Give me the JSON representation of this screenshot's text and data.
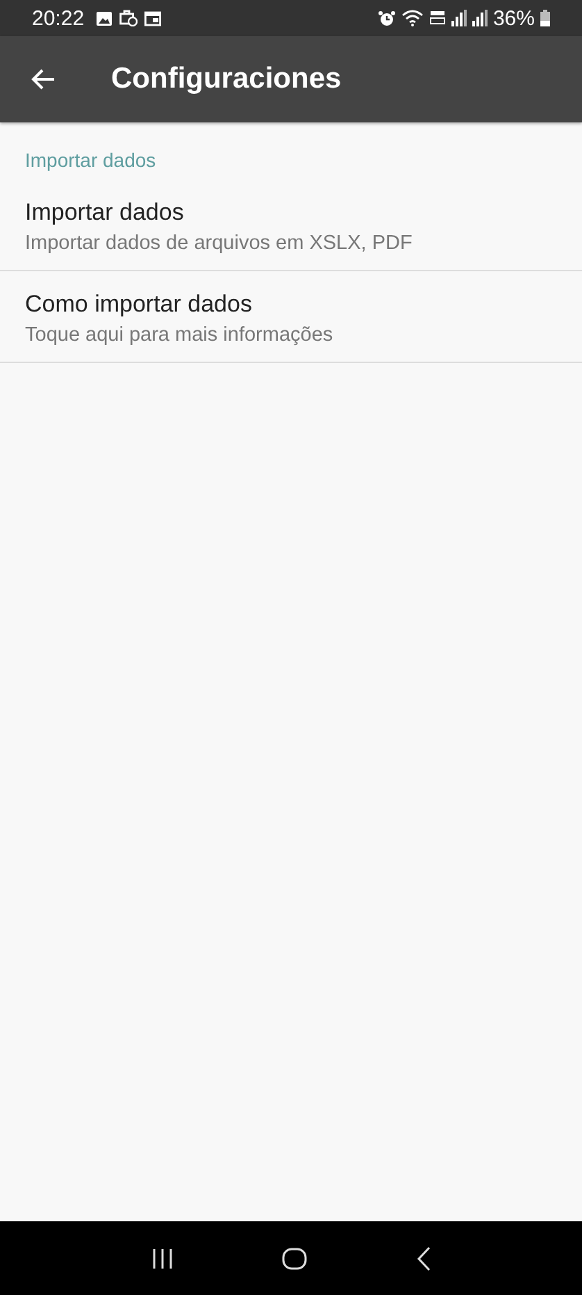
{
  "status_bar": {
    "time": "20:22",
    "battery": "36%"
  },
  "app_bar": {
    "title": "Configuraciones"
  },
  "section": {
    "header": "Importar dados",
    "items": [
      {
        "title": "Importar dados",
        "summary": "Importar dados de arquivos em XSLX, PDF"
      },
      {
        "title": "Como importar dados",
        "summary": "Toque aqui para mais informações"
      }
    ]
  }
}
